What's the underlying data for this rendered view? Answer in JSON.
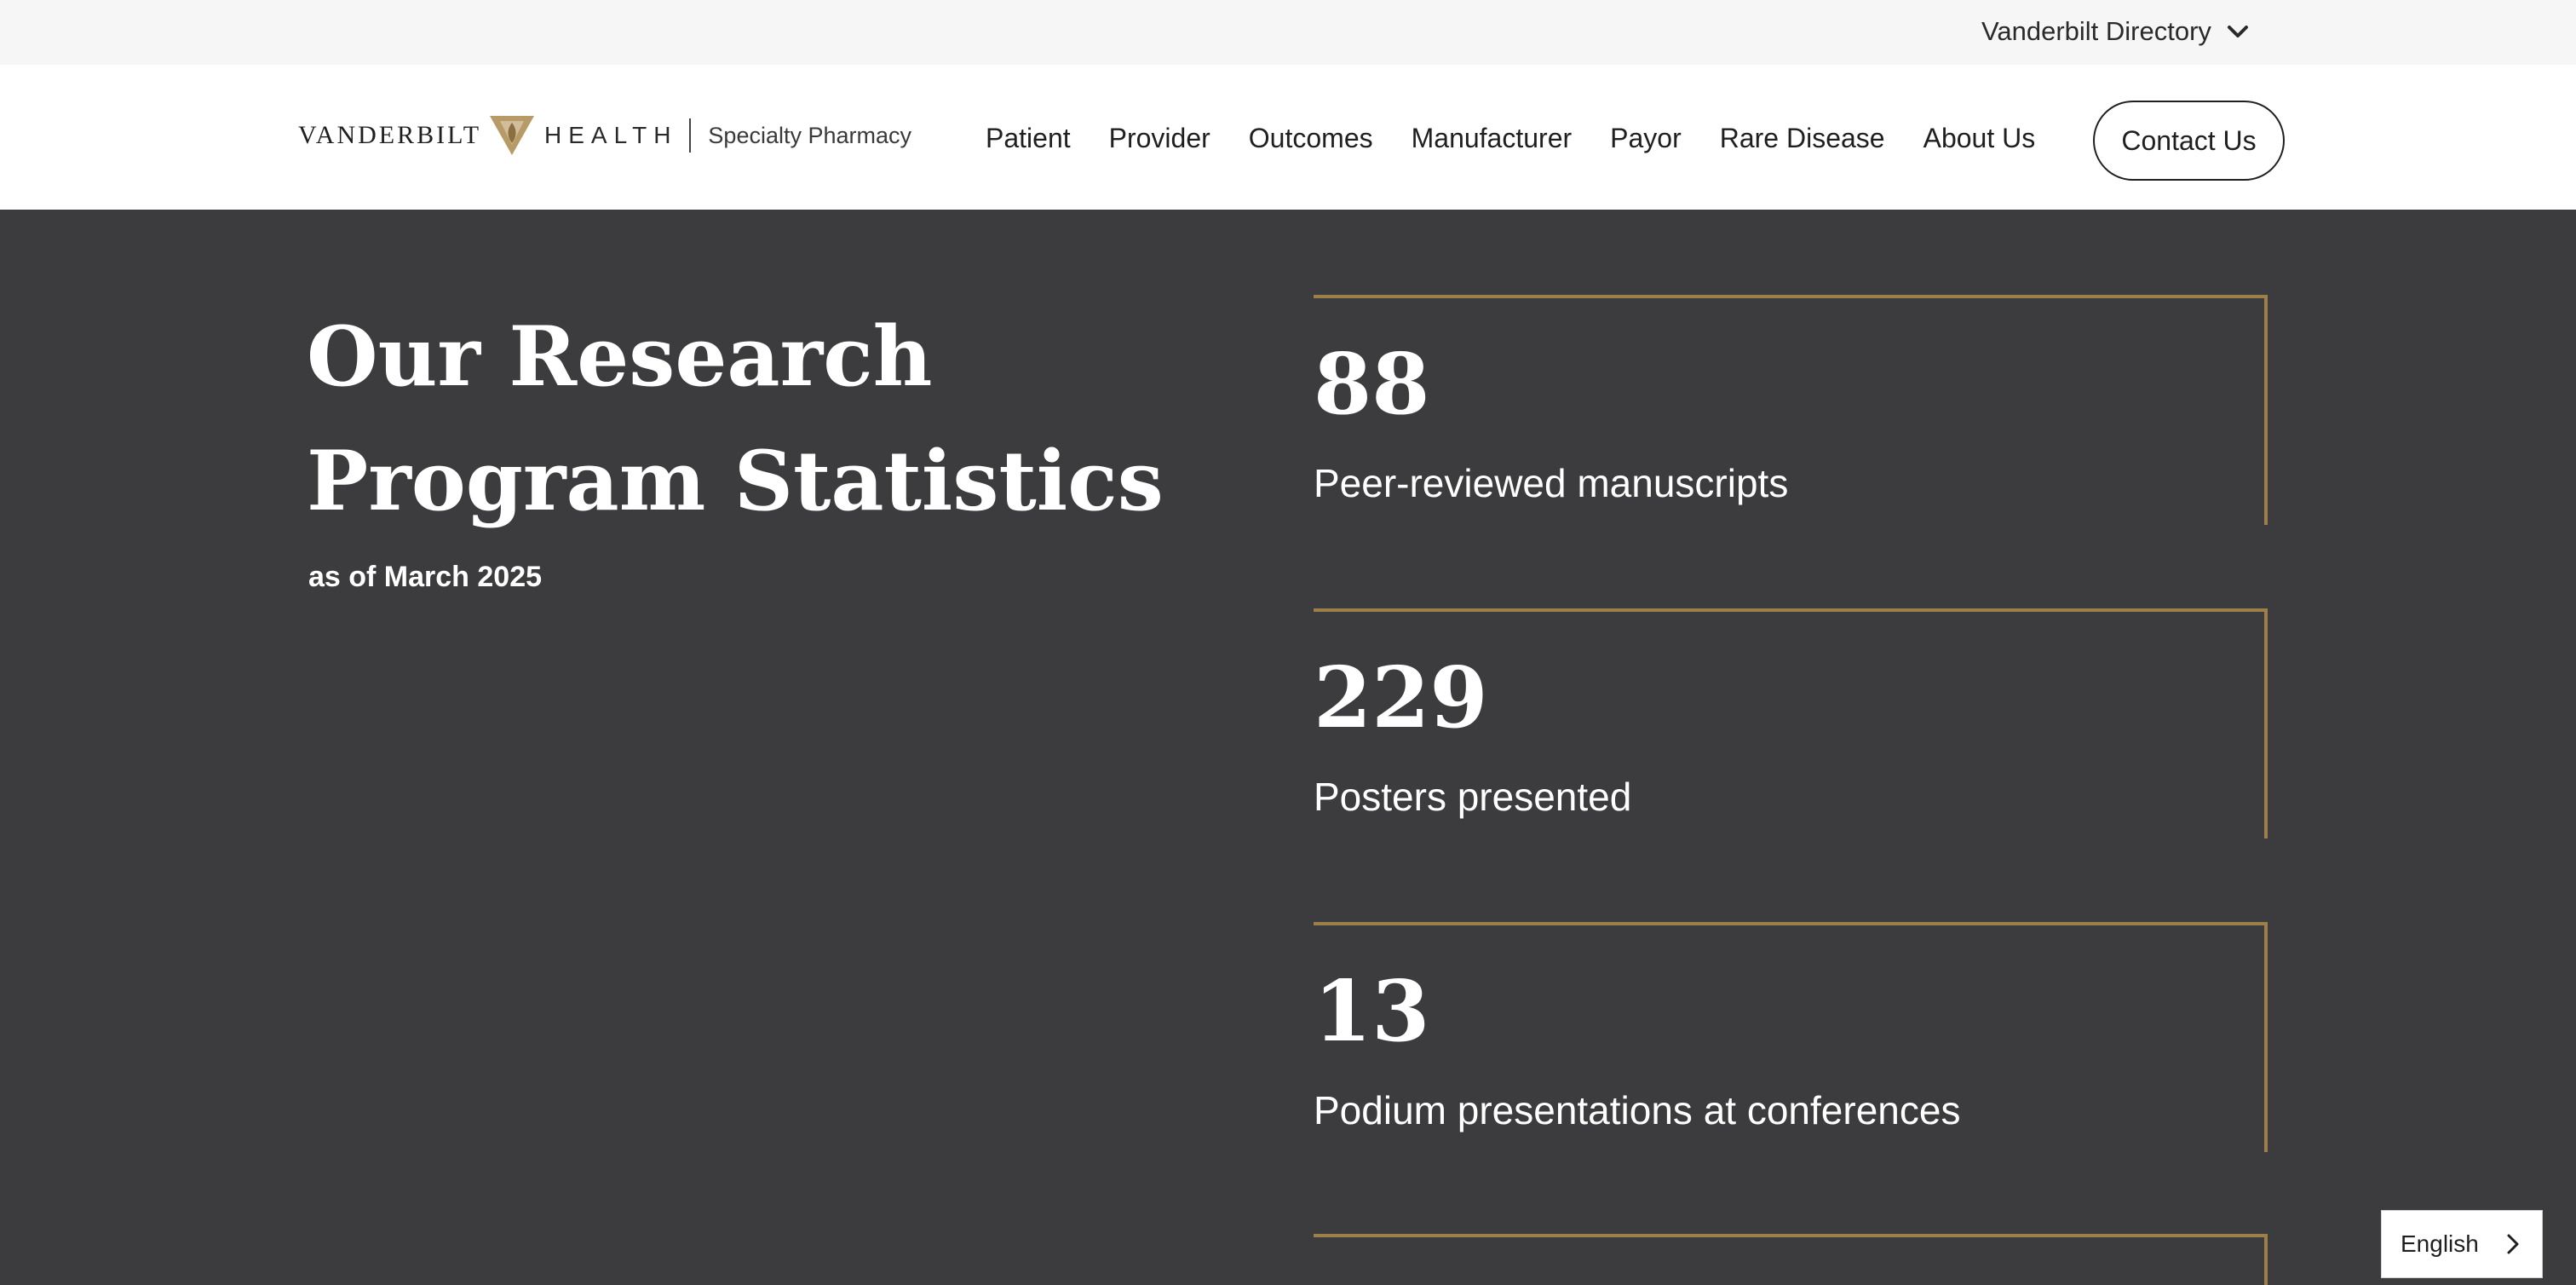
{
  "utility_bar": {
    "directory_label": "Vanderbilt Directory",
    "directory_icon": "chevron-down-icon"
  },
  "header": {
    "logo": {
      "word_1": "VANDERBILT",
      "word_2": "HEALTH",
      "sub": "Specialty Pharmacy",
      "mark_icon": "vanderbilt-v-oak-leaf-icon"
    },
    "nav": [
      {
        "label": "Patient"
      },
      {
        "label": "Provider"
      },
      {
        "label": "Outcomes"
      },
      {
        "label": "Manufacturer"
      },
      {
        "label": "Payor"
      },
      {
        "label": "Rare Disease"
      },
      {
        "label": "About Us"
      }
    ],
    "contact_label": "Contact Us"
  },
  "stats_section": {
    "title": "Our Research Program Statistics",
    "subtitle": "as of March 2025",
    "stats": [
      {
        "number": "88",
        "label": "Peer-reviewed manuscripts"
      },
      {
        "number": "229",
        "label": "Posters presented"
      },
      {
        "number": "13",
        "label": "Podium presentations at conferences"
      }
    ]
  },
  "language_switcher": {
    "label": "English",
    "icon": "chevron-right-icon"
  },
  "colors": {
    "section_bg": "#3c3c3e",
    "accent_gold": "#9c7f4a",
    "utility_bg": "#f6f6f6",
    "header_bg": "#ffffff"
  }
}
